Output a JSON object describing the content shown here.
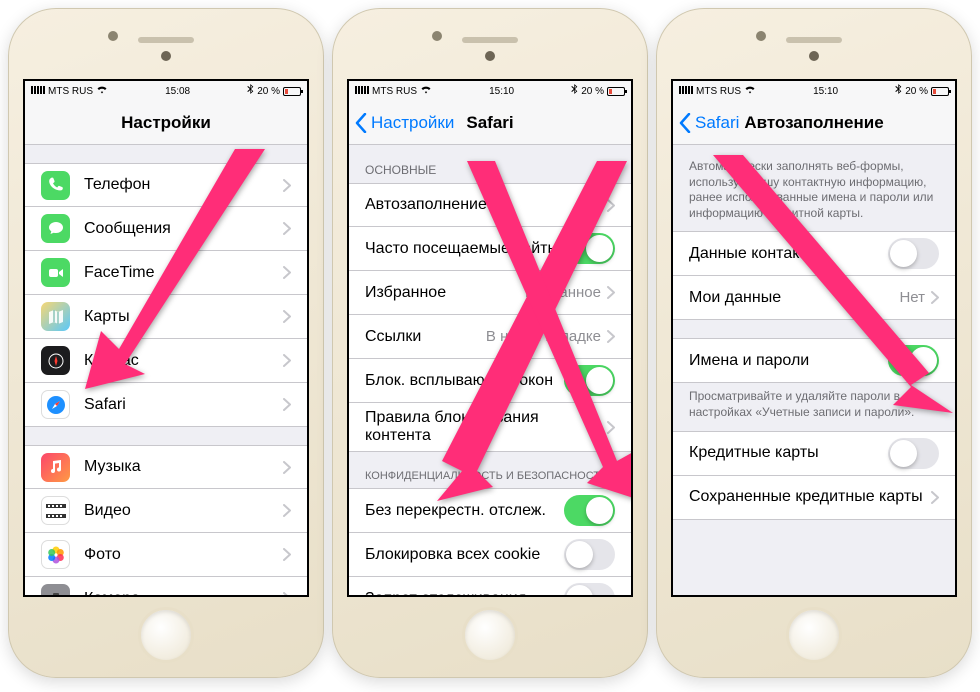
{
  "status": {
    "carrier": "MTS RUS",
    "time1": "15:08",
    "time2": "15:10",
    "time3": "15:10",
    "battery": "20 %"
  },
  "screen1": {
    "title": "Настройки",
    "items": [
      {
        "label": "Телефон",
        "icon": "phone-ic"
      },
      {
        "label": "Сообщения",
        "icon": "msg-ic"
      },
      {
        "label": "FaceTime",
        "icon": "facetime-ic"
      },
      {
        "label": "Карты",
        "icon": "maps-ic"
      },
      {
        "label": "Компас",
        "icon": "compass-ic"
      },
      {
        "label": "Safari",
        "icon": "safari-ic"
      }
    ],
    "group2": [
      {
        "label": "Музыка",
        "icon": "music-ic"
      },
      {
        "label": "Видео",
        "icon": "video-ic"
      },
      {
        "label": "Фото",
        "icon": "photos-ic"
      },
      {
        "label": "Камера",
        "icon": "camera-ic"
      }
    ]
  },
  "screen2": {
    "back": "Настройки",
    "title": "Safari",
    "section1_header": "ОСНОВНЫЕ",
    "rows1": [
      {
        "label": "Автозаполнение",
        "type": "chevron"
      },
      {
        "label": "Часто посещаемые сайты",
        "type": "toggle",
        "on": true
      },
      {
        "label": "Избранное",
        "detail": "Избранное",
        "type": "chevron"
      },
      {
        "label": "Ссылки",
        "detail": "В новой вкладке",
        "type": "chevron"
      },
      {
        "label": "Блок. всплывающих окон",
        "type": "toggle",
        "on": true
      },
      {
        "label": "Правила блокирования контента",
        "type": "chevron"
      }
    ],
    "section2_header": "КОНФИДЕНЦИАЛЬНОСТЬ И БЕЗОПАСНОСТЬ",
    "rows2": [
      {
        "label": "Без перекрестн. отслеж.",
        "type": "toggle",
        "on": true
      },
      {
        "label": "Блокировка всех cookie",
        "type": "toggle",
        "on": false
      },
      {
        "label": "Запрет отслеживания",
        "type": "toggle",
        "on": false
      }
    ]
  },
  "screen3": {
    "back": "Safari",
    "title": "Автозаполнение",
    "intro": "Автоматически заполнять веб-формы, используя Вашу контактную информацию, ранее использованные имена и пароли или информацию кредитной карты.",
    "rows1": [
      {
        "label": "Данные контакта",
        "type": "toggle",
        "on": false
      },
      {
        "label": "Мои данные",
        "detail": "Нет",
        "type": "chevron"
      }
    ],
    "rows2": [
      {
        "label": "Имена и пароли",
        "type": "toggle",
        "on": true
      }
    ],
    "footer2": "Просматривайте и удаляйте пароли в настройках «Учетные записи и пароли».",
    "rows3": [
      {
        "label": "Кредитные карты",
        "type": "toggle",
        "on": false
      },
      {
        "label": "Сохраненные кредитные карты",
        "type": "chevron"
      }
    ]
  }
}
